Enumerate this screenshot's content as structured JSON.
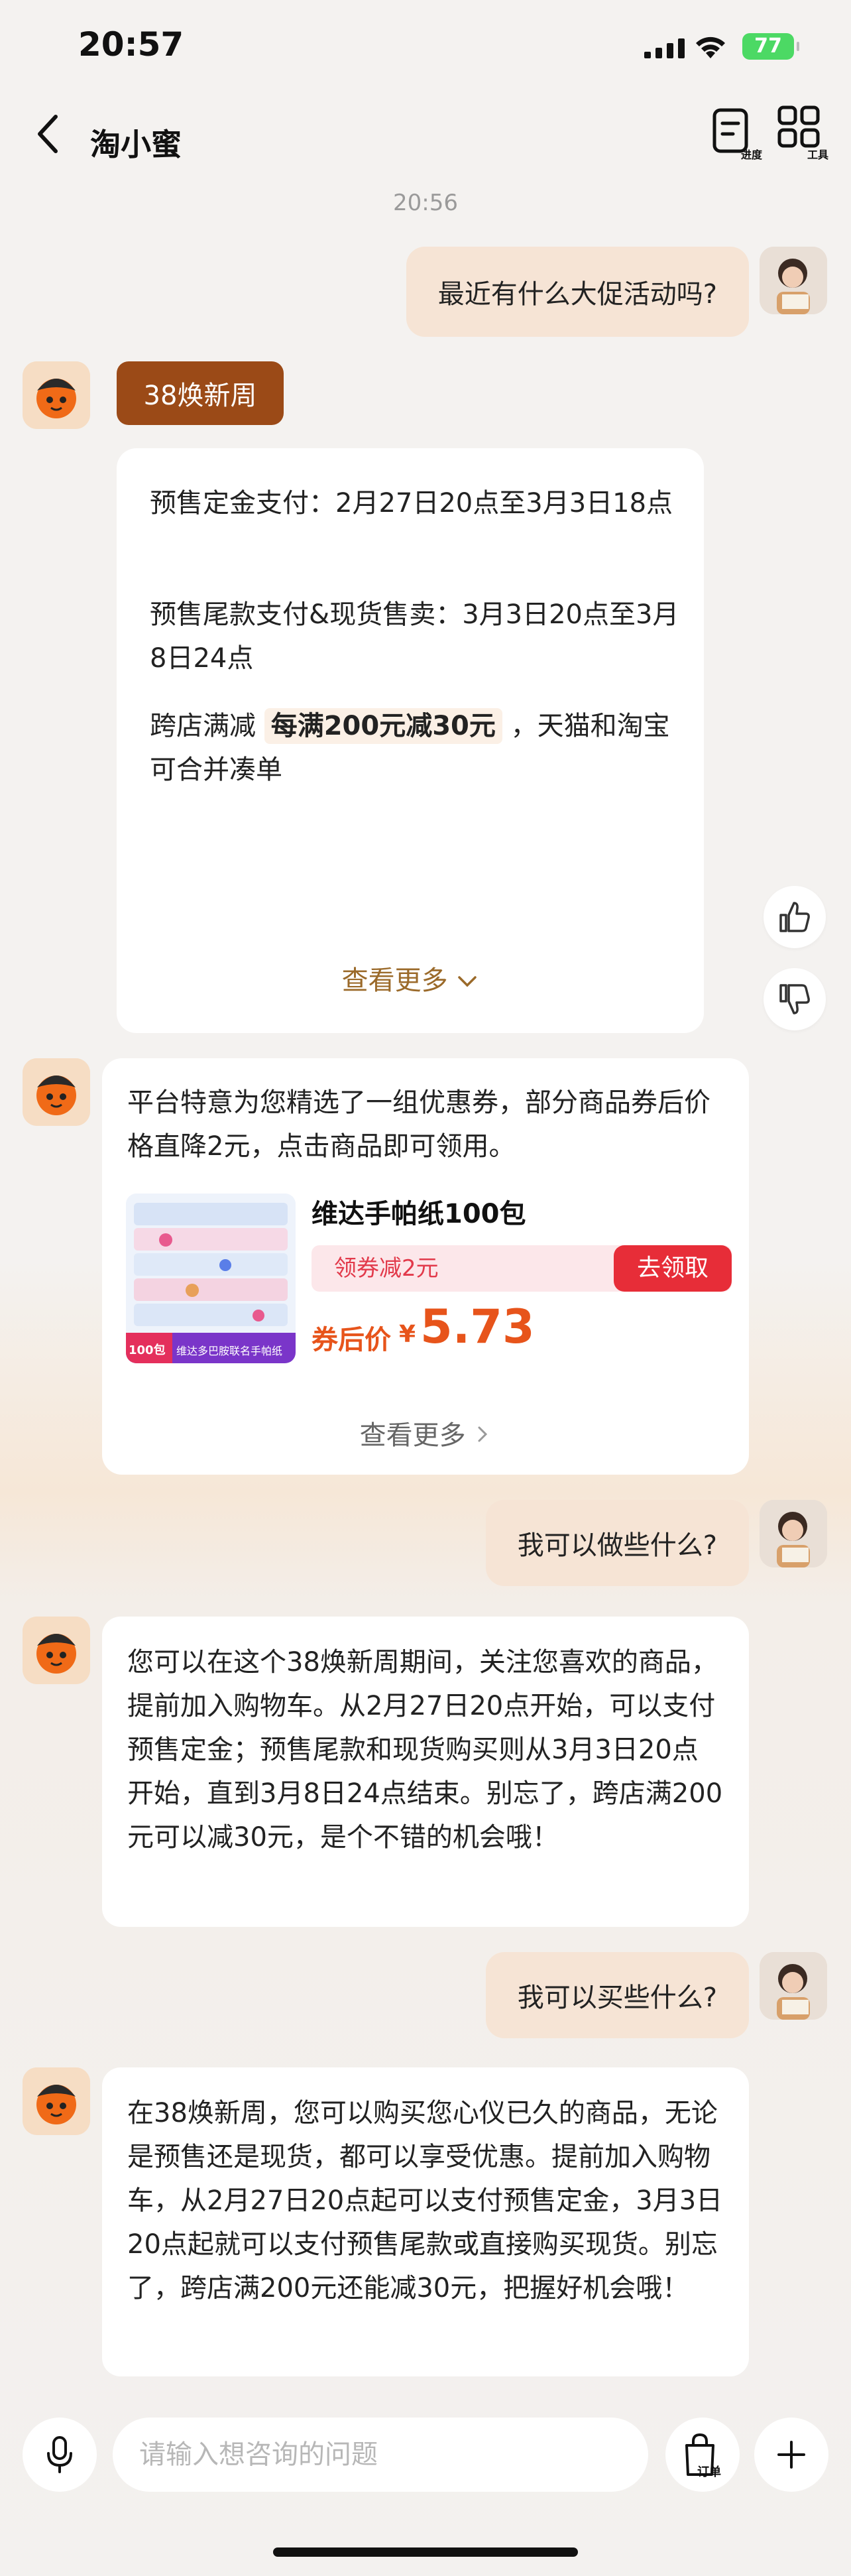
{
  "status_bar": {
    "time": "20:57",
    "battery": "77"
  },
  "nav": {
    "title": "淘小蜜",
    "tools": [
      {
        "label": "进度"
      },
      {
        "label": "工具"
      }
    ]
  },
  "chat": {
    "timestamp": "20:56",
    "q1": "最近有什么大促活动吗?",
    "tag": "38焕新周",
    "promo": {
      "line1": "预售定金支付：2月27日20点至3月3日18点",
      "line2": "预售尾款支付&现货售卖：3月3日20点至3月8日24点",
      "line3_pre": "跨店满减",
      "line3_highlight": "每满200元减30元",
      "line3_post": "，天猫和淘宝可合并凑单",
      "see_more": "查看更多"
    },
    "coupon": {
      "intro": "平台特意为您精选了一组优惠券，部分商品券后价格直降2元，点击商品即可领用。",
      "product_name": "维达手帕纸100包",
      "coupon_text": "领券减2元",
      "claim": "去领取",
      "price_label": "券后价",
      "currency": "¥",
      "price": "5.73",
      "see_more": "查看更多",
      "image_badge": "100包",
      "image_caption": "维达多巴胺联名手帕纸"
    },
    "q2": "我可以做些什么?",
    "a2": "您可以在这个38焕新周期间，关注您喜欢的商品，提前加入购物车。从2月27日20点开始，可以支付预售定金；预售尾款和现货购买则从3月3日20点开始，直到3月8日24点结束。别忘了，跨店满200元可以减30元，是个不错的机会哦！",
    "q3": "我可以买些什么?",
    "a3": "在38焕新周，您可以购买您心仪已久的商品，无论是预售还是现货，都可以享受优惠。提前加入购物车，从2月27日20点起可以支付预售定金，3月3日20点起就可以支付预售尾款或直接购买现货。别忘了，跨店满200元还能减30元，把握好机会哦！"
  },
  "input": {
    "placeholder": "请输入想咨询的问题",
    "order_label": "订单"
  },
  "colors": {
    "tag_brown": "#9b4a17",
    "price_orange": "#e7541b",
    "claim_red": "#e72d38",
    "user_bubble": "#f6e4d5"
  }
}
